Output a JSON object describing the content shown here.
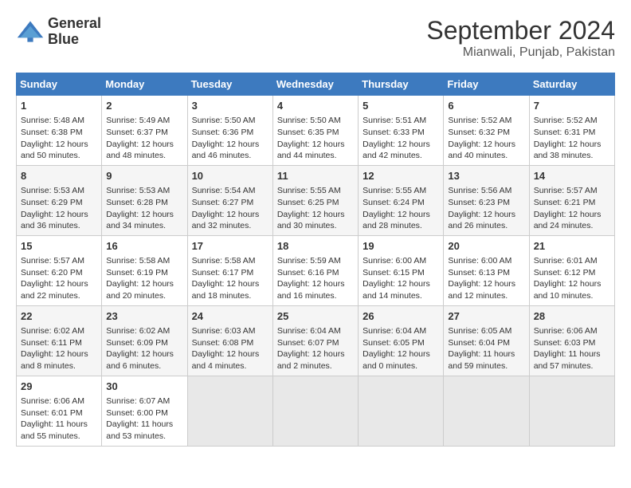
{
  "header": {
    "logo_line1": "General",
    "logo_line2": "Blue",
    "title": "September 2024",
    "subtitle": "Mianwali, Punjab, Pakistan"
  },
  "weekdays": [
    "Sunday",
    "Monday",
    "Tuesday",
    "Wednesday",
    "Thursday",
    "Friday",
    "Saturday"
  ],
  "weeks": [
    [
      {
        "day": "1",
        "info": "Sunrise: 5:48 AM\nSunset: 6:38 PM\nDaylight: 12 hours\nand 50 minutes."
      },
      {
        "day": "2",
        "info": "Sunrise: 5:49 AM\nSunset: 6:37 PM\nDaylight: 12 hours\nand 48 minutes."
      },
      {
        "day": "3",
        "info": "Sunrise: 5:50 AM\nSunset: 6:36 PM\nDaylight: 12 hours\nand 46 minutes."
      },
      {
        "day": "4",
        "info": "Sunrise: 5:50 AM\nSunset: 6:35 PM\nDaylight: 12 hours\nand 44 minutes."
      },
      {
        "day": "5",
        "info": "Sunrise: 5:51 AM\nSunset: 6:33 PM\nDaylight: 12 hours\nand 42 minutes."
      },
      {
        "day": "6",
        "info": "Sunrise: 5:52 AM\nSunset: 6:32 PM\nDaylight: 12 hours\nand 40 minutes."
      },
      {
        "day": "7",
        "info": "Sunrise: 5:52 AM\nSunset: 6:31 PM\nDaylight: 12 hours\nand 38 minutes."
      }
    ],
    [
      {
        "day": "8",
        "info": "Sunrise: 5:53 AM\nSunset: 6:29 PM\nDaylight: 12 hours\nand 36 minutes."
      },
      {
        "day": "9",
        "info": "Sunrise: 5:53 AM\nSunset: 6:28 PM\nDaylight: 12 hours\nand 34 minutes."
      },
      {
        "day": "10",
        "info": "Sunrise: 5:54 AM\nSunset: 6:27 PM\nDaylight: 12 hours\nand 32 minutes."
      },
      {
        "day": "11",
        "info": "Sunrise: 5:55 AM\nSunset: 6:25 PM\nDaylight: 12 hours\nand 30 minutes."
      },
      {
        "day": "12",
        "info": "Sunrise: 5:55 AM\nSunset: 6:24 PM\nDaylight: 12 hours\nand 28 minutes."
      },
      {
        "day": "13",
        "info": "Sunrise: 5:56 AM\nSunset: 6:23 PM\nDaylight: 12 hours\nand 26 minutes."
      },
      {
        "day": "14",
        "info": "Sunrise: 5:57 AM\nSunset: 6:21 PM\nDaylight: 12 hours\nand 24 minutes."
      }
    ],
    [
      {
        "day": "15",
        "info": "Sunrise: 5:57 AM\nSunset: 6:20 PM\nDaylight: 12 hours\nand 22 minutes."
      },
      {
        "day": "16",
        "info": "Sunrise: 5:58 AM\nSunset: 6:19 PM\nDaylight: 12 hours\nand 20 minutes."
      },
      {
        "day": "17",
        "info": "Sunrise: 5:58 AM\nSunset: 6:17 PM\nDaylight: 12 hours\nand 18 minutes."
      },
      {
        "day": "18",
        "info": "Sunrise: 5:59 AM\nSunset: 6:16 PM\nDaylight: 12 hours\nand 16 minutes."
      },
      {
        "day": "19",
        "info": "Sunrise: 6:00 AM\nSunset: 6:15 PM\nDaylight: 12 hours\nand 14 minutes."
      },
      {
        "day": "20",
        "info": "Sunrise: 6:00 AM\nSunset: 6:13 PM\nDaylight: 12 hours\nand 12 minutes."
      },
      {
        "day": "21",
        "info": "Sunrise: 6:01 AM\nSunset: 6:12 PM\nDaylight: 12 hours\nand 10 minutes."
      }
    ],
    [
      {
        "day": "22",
        "info": "Sunrise: 6:02 AM\nSunset: 6:11 PM\nDaylight: 12 hours\nand 8 minutes."
      },
      {
        "day": "23",
        "info": "Sunrise: 6:02 AM\nSunset: 6:09 PM\nDaylight: 12 hours\nand 6 minutes."
      },
      {
        "day": "24",
        "info": "Sunrise: 6:03 AM\nSunset: 6:08 PM\nDaylight: 12 hours\nand 4 minutes."
      },
      {
        "day": "25",
        "info": "Sunrise: 6:04 AM\nSunset: 6:07 PM\nDaylight: 12 hours\nand 2 minutes."
      },
      {
        "day": "26",
        "info": "Sunrise: 6:04 AM\nSunset: 6:05 PM\nDaylight: 12 hours\nand 0 minutes."
      },
      {
        "day": "27",
        "info": "Sunrise: 6:05 AM\nSunset: 6:04 PM\nDaylight: 11 hours\nand 59 minutes."
      },
      {
        "day": "28",
        "info": "Sunrise: 6:06 AM\nSunset: 6:03 PM\nDaylight: 11 hours\nand 57 minutes."
      }
    ],
    [
      {
        "day": "29",
        "info": "Sunrise: 6:06 AM\nSunset: 6:01 PM\nDaylight: 11 hours\nand 55 minutes."
      },
      {
        "day": "30",
        "info": "Sunrise: 6:07 AM\nSunset: 6:00 PM\nDaylight: 11 hours\nand 53 minutes."
      },
      {
        "day": "",
        "info": ""
      },
      {
        "day": "",
        "info": ""
      },
      {
        "day": "",
        "info": ""
      },
      {
        "day": "",
        "info": ""
      },
      {
        "day": "",
        "info": ""
      }
    ]
  ]
}
